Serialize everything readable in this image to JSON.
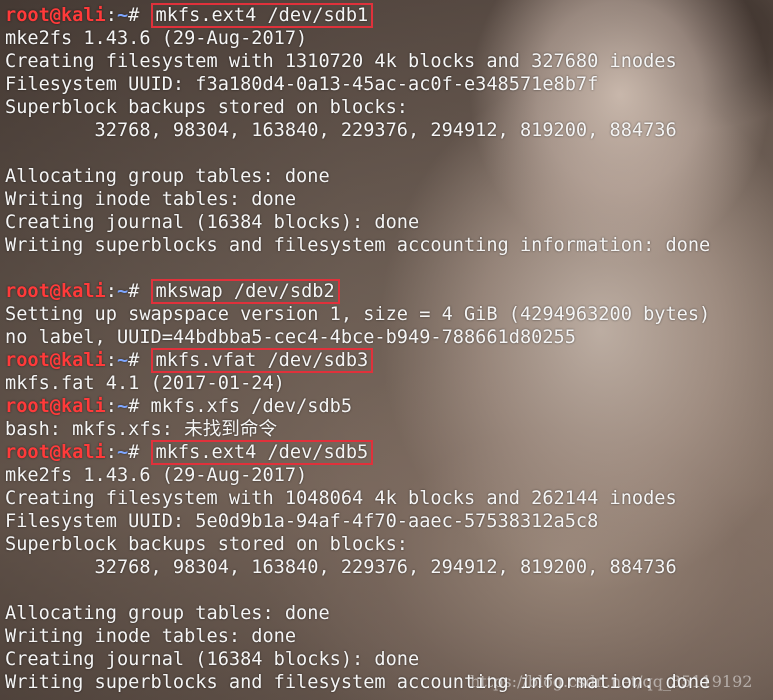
{
  "prompt": {
    "user": "root@kali",
    "sep": ":",
    "path": "~",
    "symbol": "# "
  },
  "lines": [
    {
      "kind": "prompt",
      "cmd": "mkfs.ext4 /dev/sdb1",
      "highlight": true
    },
    {
      "kind": "out",
      "text": "mke2fs 1.43.6 (29-Aug-2017)"
    },
    {
      "kind": "out",
      "text": "Creating filesystem with 1310720 4k blocks and 327680 inodes"
    },
    {
      "kind": "out",
      "text": "Filesystem UUID: f3a180d4-0a13-45ac-ac0f-e348571e8b7f"
    },
    {
      "kind": "out",
      "text": "Superblock backups stored on blocks:"
    },
    {
      "kind": "out",
      "text": "        32768, 98304, 163840, 229376, 294912, 819200, 884736"
    },
    {
      "kind": "out",
      "text": ""
    },
    {
      "kind": "out",
      "text": "Allocating group tables: done"
    },
    {
      "kind": "out",
      "text": "Writing inode tables: done"
    },
    {
      "kind": "out",
      "text": "Creating journal (16384 blocks): done"
    },
    {
      "kind": "out",
      "text": "Writing superblocks and filesystem accounting information: done"
    },
    {
      "kind": "out",
      "text": ""
    },
    {
      "kind": "prompt",
      "cmd": "mkswap /dev/sdb2",
      "highlight": true
    },
    {
      "kind": "out",
      "text": "Setting up swapspace version 1, size = 4 GiB (4294963200 bytes)"
    },
    {
      "kind": "out",
      "text": "no label, UUID=44bdbba5-cec4-4bce-b949-788661d80255"
    },
    {
      "kind": "prompt",
      "cmd": "mkfs.vfat /dev/sdb3",
      "highlight": true
    },
    {
      "kind": "out",
      "text": "mkfs.fat 4.1 (2017-01-24)"
    },
    {
      "kind": "prompt",
      "cmd": "mkfs.xfs /dev/sdb5",
      "highlight": false
    },
    {
      "kind": "out",
      "text": "bash: mkfs.xfs: 未找到命令"
    },
    {
      "kind": "prompt",
      "cmd": "mkfs.ext4 /dev/sdb5",
      "highlight": true
    },
    {
      "kind": "out",
      "text": "mke2fs 1.43.6 (29-Aug-2017)"
    },
    {
      "kind": "out",
      "text": "Creating filesystem with 1048064 4k blocks and 262144 inodes"
    },
    {
      "kind": "out",
      "text": "Filesystem UUID: 5e0d9b1a-94af-4f70-aaec-57538312a5c8"
    },
    {
      "kind": "out",
      "text": "Superblock backups stored on blocks:"
    },
    {
      "kind": "out",
      "text": "        32768, 98304, 163840, 229376, 294912, 819200, 884736"
    },
    {
      "kind": "out",
      "text": ""
    },
    {
      "kind": "out",
      "text": "Allocating group tables: done"
    },
    {
      "kind": "out",
      "text": "Writing inode tables: done"
    },
    {
      "kind": "out",
      "text": "Creating journal (16384 blocks): done"
    },
    {
      "kind": "out",
      "text": "Writing superblocks and filesystem accounting information: done"
    }
  ],
  "watermark": "https://blog.csdn.net/qq_35119192",
  "colors": {
    "user": "#ff3a3a",
    "path": "#7ea6ff",
    "highlight_box": "#e0313b",
    "text": "#f5f5f5"
  }
}
